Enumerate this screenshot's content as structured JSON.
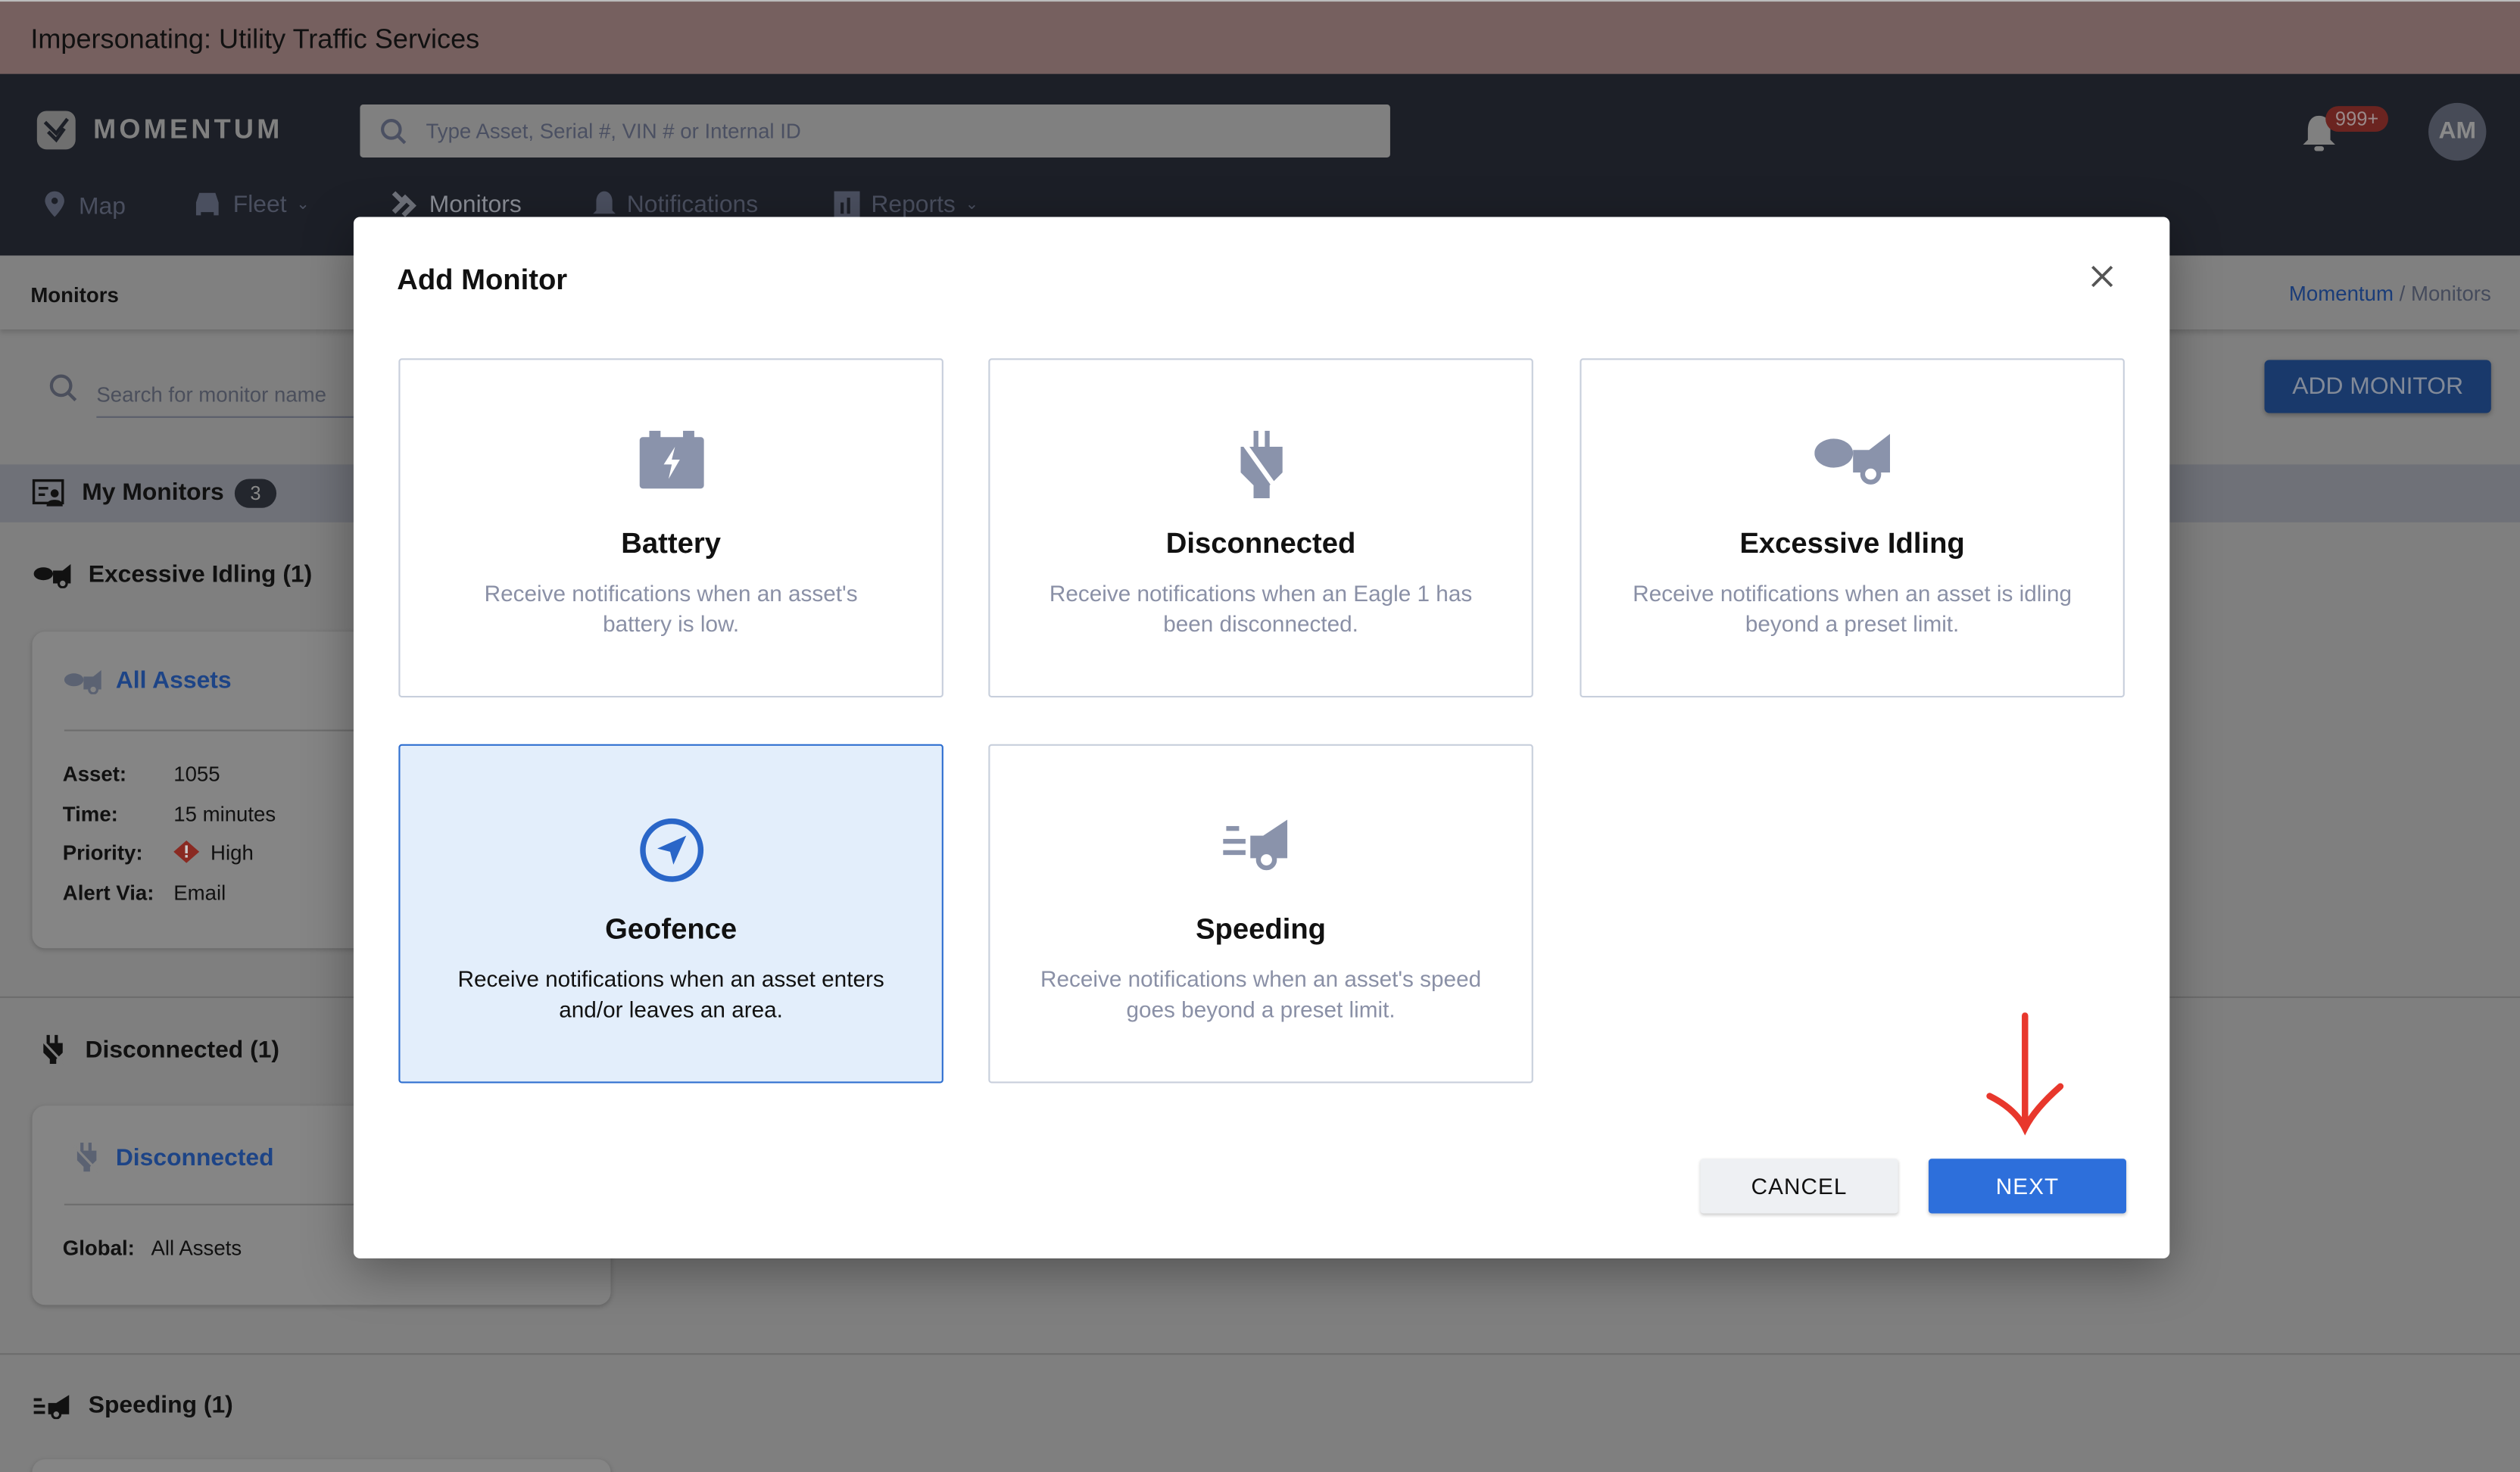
{
  "banner": {
    "text": "Impersonating: Utility Traffic Services"
  },
  "header": {
    "logo_text": "MOMENTUM",
    "search_placeholder": "Type Asset, Serial #, VIN # or Internal ID",
    "nav": [
      {
        "label": "Map",
        "icon": "map-pin-icon"
      },
      {
        "label": "Fleet",
        "icon": "car-icon",
        "dropdown": true
      },
      {
        "label": "Monitors",
        "icon": "monitors-icon",
        "active": true
      },
      {
        "label": "Notifications",
        "icon": "bell-icon"
      },
      {
        "label": "Reports",
        "icon": "chart-icon",
        "dropdown": true
      }
    ],
    "notification_badge": "999+",
    "avatar_initials": "AM"
  },
  "subheader": {
    "title": "Monitors",
    "breadcrumb": {
      "root": "Momentum",
      "separator": " / ",
      "current": "Monitors"
    }
  },
  "page": {
    "search_placeholder": "Search for monitor name",
    "add_monitor_label": "ADD MONITOR",
    "my_monitors_label": "My Monitors",
    "my_monitors_count": "3",
    "sections": [
      {
        "title": "Excessive Idling (1)",
        "card_title": "All Assets",
        "fields": [
          [
            "Asset:",
            "1055"
          ],
          [
            "Time:",
            "15 minutes"
          ],
          [
            "Priority:",
            "High"
          ],
          [
            "Alert Via:",
            "Email"
          ]
        ]
      },
      {
        "title": "Disconnected (1)",
        "card_title": "Disconnected",
        "fields": [
          [
            "Global:",
            "All Assets"
          ]
        ]
      },
      {
        "title": "Speeding (1)"
      }
    ]
  },
  "modal": {
    "title": "Add Monitor",
    "options": [
      {
        "title": "Battery",
        "desc": "Receive notifications when an asset's battery is low.",
        "icon": "battery-icon"
      },
      {
        "title": "Disconnected",
        "desc": "Receive notifications when an Eagle 1 has been disconnected.",
        "icon": "unplugged-icon"
      },
      {
        "title": "Excessive Idling",
        "desc": "Receive notifications when an asset is idling beyond a preset limit.",
        "icon": "idling-truck-icon"
      },
      {
        "title": "Geofence",
        "desc": "Receive notifications when an asset enters and/or leaves an area.",
        "icon": "navigation-arrow-icon",
        "selected": true
      },
      {
        "title": "Speeding",
        "desc": "Receive notifications when an asset's speed goes beyond a preset limit.",
        "icon": "speeding-truck-icon"
      }
    ],
    "cancel_label": "CANCEL",
    "next_label": "NEXT"
  },
  "colors": {
    "accent": "#2d6fdb",
    "selected_bg": "#e3eefb",
    "icon": "#8a93ab",
    "annotation_arrow": "#e8372c"
  }
}
